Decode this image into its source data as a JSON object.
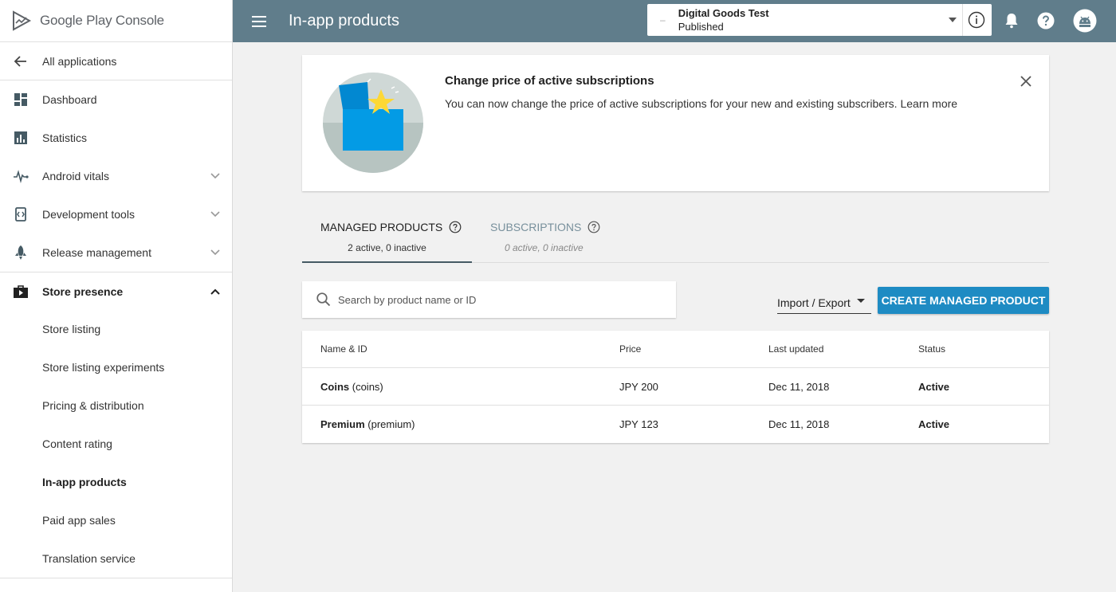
{
  "brand": {
    "name": "Google Play Console"
  },
  "sidebar": {
    "back": {
      "label": "All applications",
      "icon": "arrow-back-icon"
    },
    "items": [
      {
        "label": "Dashboard",
        "icon": "dashboard-icon"
      },
      {
        "label": "Statistics",
        "icon": "statistics-icon"
      },
      {
        "label": "Android vitals",
        "icon": "vitals-icon"
      },
      {
        "label": "Development tools",
        "icon": "dev-tools-icon"
      },
      {
        "label": "Release management",
        "icon": "rocket-icon"
      }
    ],
    "section": {
      "label": "Store presence",
      "icon": "store-icon"
    },
    "sub_items": [
      {
        "label": "Store listing"
      },
      {
        "label": "Store listing experiments"
      },
      {
        "label": "Pricing & distribution"
      },
      {
        "label": "Content rating"
      },
      {
        "label": "In-app products"
      },
      {
        "label": "Paid app sales"
      },
      {
        "label": "Translation service"
      }
    ]
  },
  "topbar": {
    "title": "In-app products",
    "app_name": "Digital Goods Test",
    "app_status": "Published",
    "dash": "–"
  },
  "banner": {
    "title": "Change price of active subscriptions",
    "body": "You can now change the price of active subscriptions for your new and existing subscribers.",
    "link": "Learn more"
  },
  "tabs": [
    {
      "title": "MANAGED PRODUCTS",
      "sub": "2 active, 0 inactive"
    },
    {
      "title": "SUBSCRIPTIONS",
      "sub": "0 active, 0 inactive"
    }
  ],
  "search": {
    "placeholder": "Search by product name or ID"
  },
  "actions": {
    "import_export": "Import / Export",
    "create": "CREATE MANAGED PRODUCT"
  },
  "table": {
    "headers": [
      "Name & ID",
      "Price",
      "Last updated",
      "Status"
    ],
    "rows": [
      {
        "name": "Coins",
        "id": "(coins)",
        "price": "JPY 200",
        "updated": "Dec 11, 2018",
        "status": "Active"
      },
      {
        "name": "Premium",
        "id": "(premium)",
        "price": "JPY 123",
        "updated": "Dec 11, 2018",
        "status": "Active"
      }
    ]
  },
  "colors": {
    "topbar": "#607d8b",
    "primary_button": "#1e8bc3",
    "background": "#f1f1f1"
  }
}
